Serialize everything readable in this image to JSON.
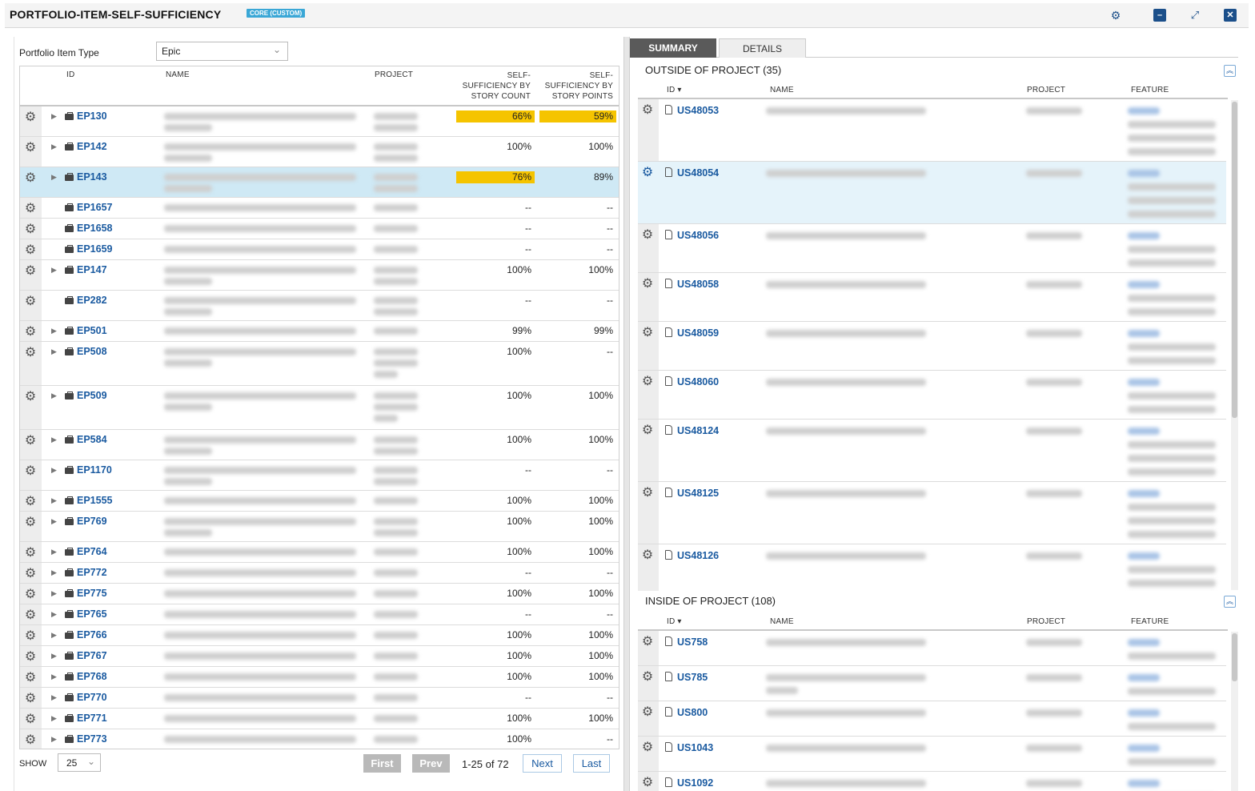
{
  "app": {
    "title": "PORTFOLIO-ITEM-SELF-SUFFICIENCY",
    "badge": "CORE (CUSTOM)",
    "accent": "#1b4f8a",
    "link_color": "#1a5aa0",
    "highlight_color": "#f5c400"
  },
  "toolbar": {
    "icons": [
      "gear-icon",
      "minimize-icon",
      "expand-icon",
      "close-icon"
    ]
  },
  "left": {
    "type_label": "Portfolio Item Type",
    "type_value": "Epic",
    "columns": {
      "id": "ID",
      "name": "NAME",
      "project": "PROJECT",
      "by_count": "SELF-SUFFICIENCY BY STORY COUNT",
      "by_points": "SELF-SUFFICIENCY BY STORY POINTS"
    },
    "rows": [
      {
        "id": "EP130",
        "count": "66%",
        "points": "59%",
        "count_hl": true,
        "points_hl": true,
        "expand": true
      },
      {
        "id": "EP142",
        "count": "100%",
        "points": "100%",
        "expand": true
      },
      {
        "id": "EP143",
        "count": "76%",
        "points": "89%",
        "count_hl": true,
        "expand": true,
        "selected": true
      },
      {
        "id": "EP1657",
        "count": "--",
        "points": "--",
        "expand": false
      },
      {
        "id": "EP1658",
        "count": "--",
        "points": "--",
        "expand": false
      },
      {
        "id": "EP1659",
        "count": "--",
        "points": "--",
        "expand": false
      },
      {
        "id": "EP147",
        "count": "100%",
        "points": "100%",
        "expand": true
      },
      {
        "id": "EP282",
        "count": "--",
        "points": "--",
        "expand": false
      },
      {
        "id": "EP501",
        "count": "99%",
        "points": "99%",
        "expand": true
      },
      {
        "id": "EP508",
        "count": "100%",
        "points": "--",
        "expand": true
      },
      {
        "id": "EP509",
        "count": "100%",
        "points": "100%",
        "expand": true
      },
      {
        "id": "EP584",
        "count": "100%",
        "points": "100%",
        "expand": true
      },
      {
        "id": "EP1170",
        "count": "--",
        "points": "--",
        "expand": true
      },
      {
        "id": "EP1555",
        "count": "100%",
        "points": "100%",
        "expand": true
      },
      {
        "id": "EP769",
        "count": "100%",
        "points": "100%",
        "expand": true
      },
      {
        "id": "EP764",
        "count": "100%",
        "points": "100%",
        "expand": true
      },
      {
        "id": "EP772",
        "count": "--",
        "points": "--",
        "expand": true
      },
      {
        "id": "EP775",
        "count": "100%",
        "points": "100%",
        "expand": true
      },
      {
        "id": "EP765",
        "count": "--",
        "points": "--",
        "expand": true
      },
      {
        "id": "EP766",
        "count": "100%",
        "points": "100%",
        "expand": true
      },
      {
        "id": "EP767",
        "count": "100%",
        "points": "100%",
        "expand": true
      },
      {
        "id": "EP768",
        "count": "100%",
        "points": "100%",
        "expand": true
      },
      {
        "id": "EP770",
        "count": "--",
        "points": "--",
        "expand": true
      },
      {
        "id": "EP771",
        "count": "100%",
        "points": "100%",
        "expand": true
      },
      {
        "id": "EP773",
        "count": "100%",
        "points": "--",
        "expand": true
      }
    ],
    "footer": {
      "show_label": "SHOW",
      "page_size": "25",
      "first": "First",
      "prev": "Prev",
      "page_info": "1-25 of 72",
      "next": "Next",
      "last": "Last"
    }
  },
  "right": {
    "tabs": [
      "SUMMARY",
      "DETAILS"
    ],
    "outside": {
      "title": "OUTSIDE OF PROJECT (35)",
      "columns": {
        "id": "ID ▾",
        "name": "NAME",
        "project": "PROJECT",
        "feature": "FEATURE"
      },
      "rows": [
        {
          "id": "US48053"
        },
        {
          "id": "US48054",
          "selected": true
        },
        {
          "id": "US48056"
        },
        {
          "id": "US48058"
        },
        {
          "id": "US48059"
        },
        {
          "id": "US48060"
        },
        {
          "id": "US48124"
        },
        {
          "id": "US48125"
        },
        {
          "id": "US48126"
        }
      ]
    },
    "inside": {
      "title": "INSIDE OF PROJECT (108)",
      "columns": {
        "id": "ID ▾",
        "name": "NAME",
        "project": "PROJECT",
        "feature": "FEATURE"
      },
      "rows": [
        {
          "id": "US758"
        },
        {
          "id": "US785"
        },
        {
          "id": "US800"
        },
        {
          "id": "US1043"
        },
        {
          "id": "US1092"
        }
      ]
    }
  }
}
